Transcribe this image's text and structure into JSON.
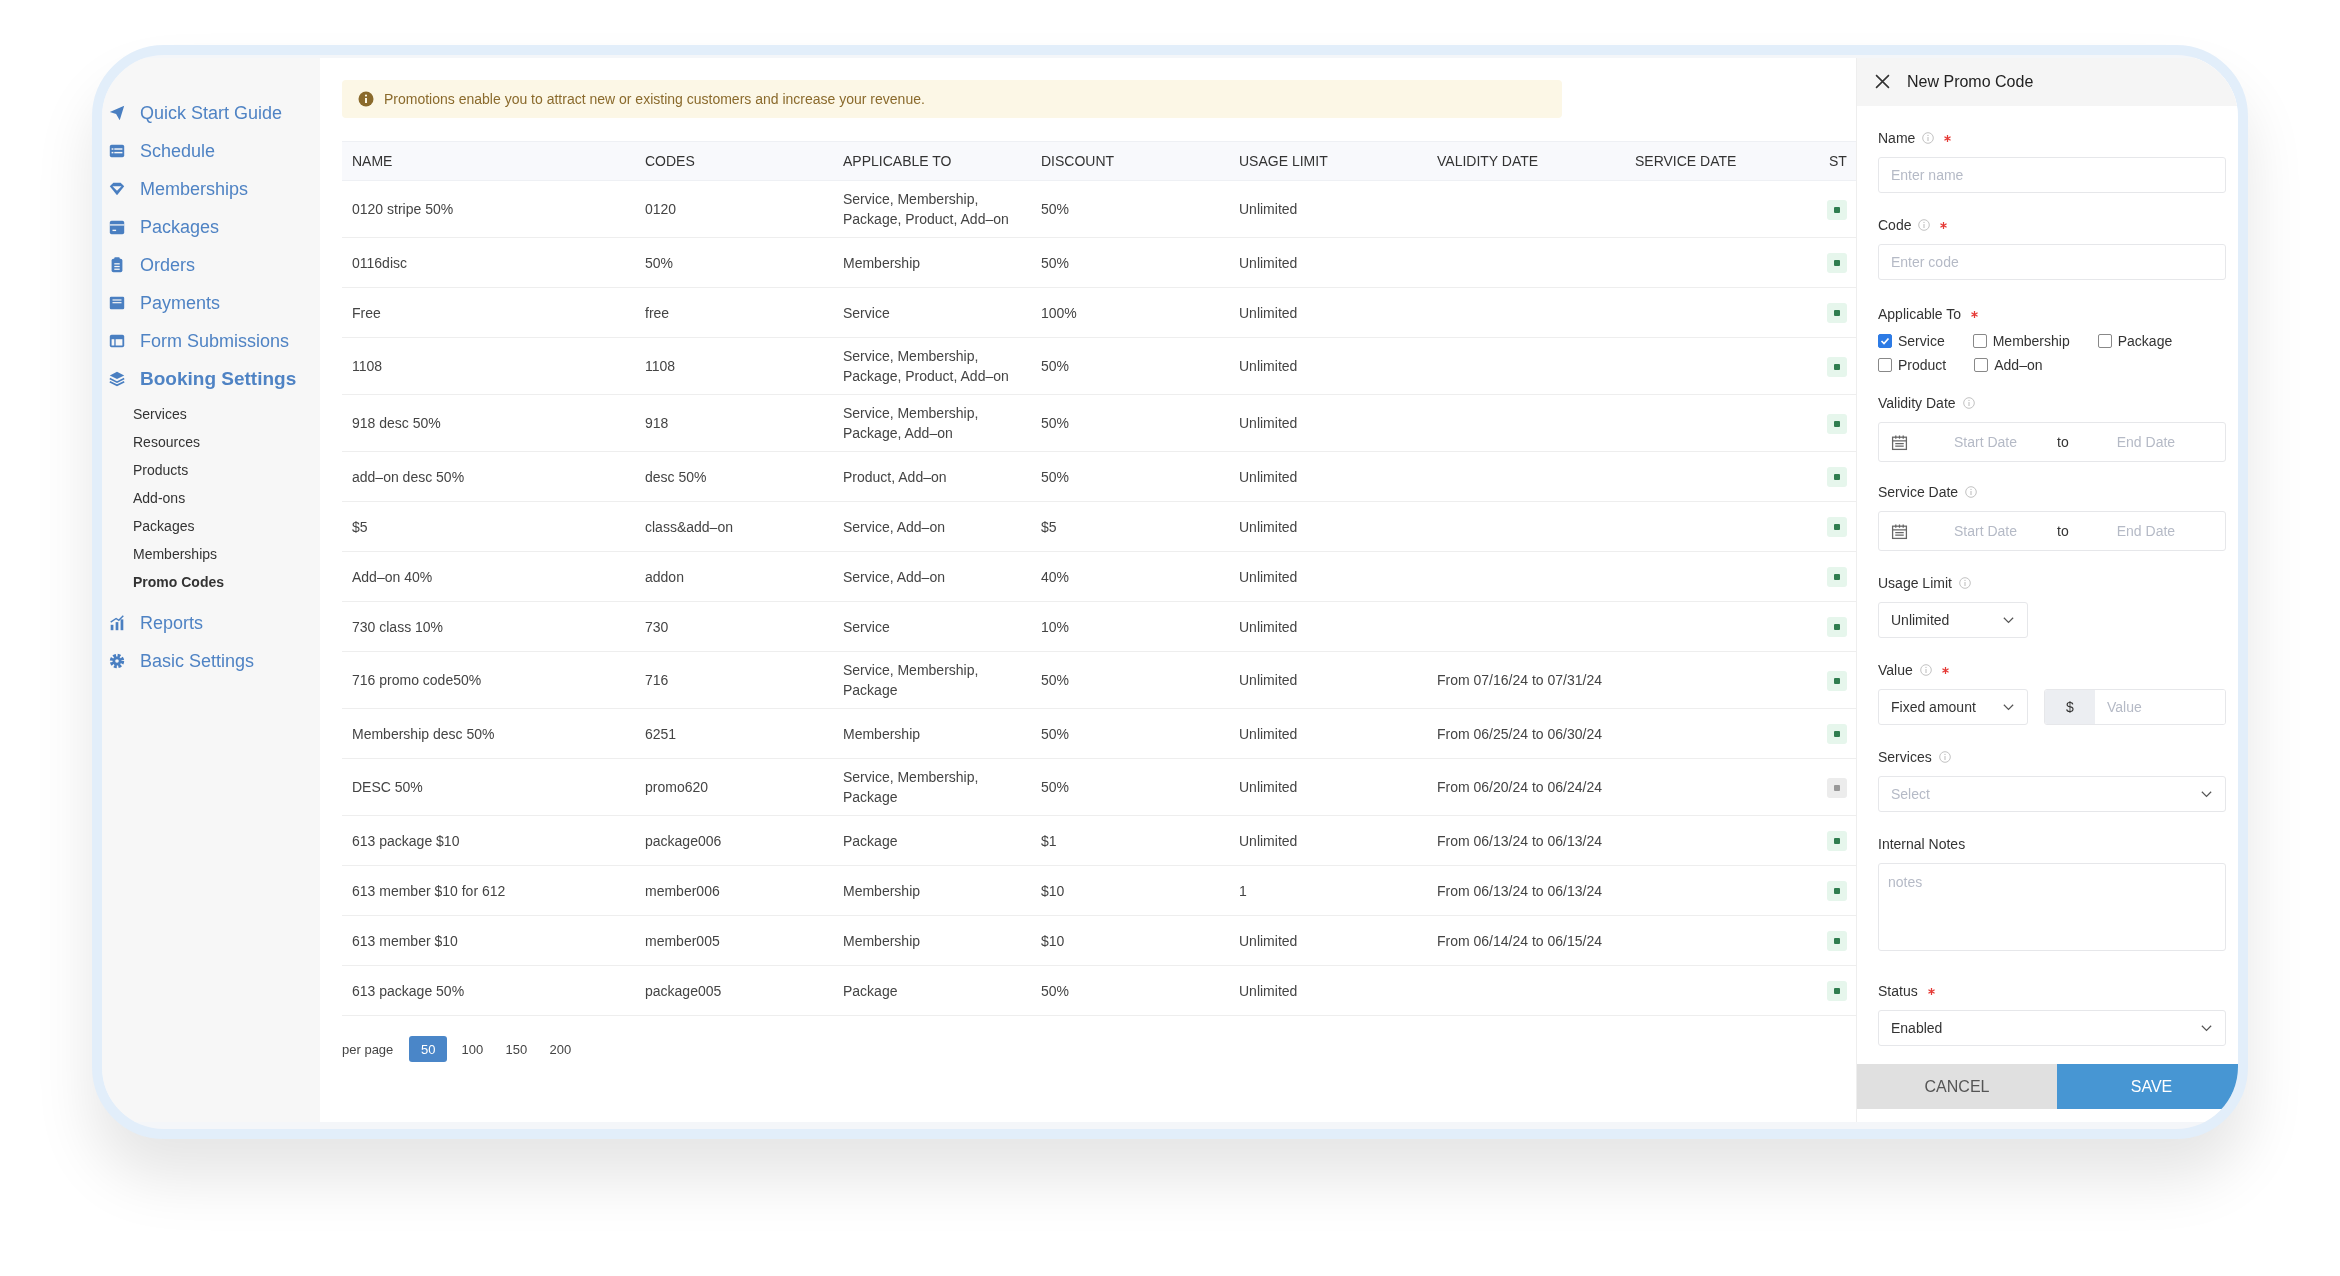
{
  "sidebar": {
    "items": [
      {
        "label": "Quick Start Guide",
        "expanded": false
      },
      {
        "label": "Schedule",
        "expanded": false
      },
      {
        "label": "Memberships",
        "expanded": false
      },
      {
        "label": "Packages",
        "expanded": false
      },
      {
        "label": "Orders",
        "expanded": false
      },
      {
        "label": "Payments",
        "expanded": false
      },
      {
        "label": "Form Submissions",
        "expanded": false
      },
      {
        "label": "Booking Settings",
        "expanded": true,
        "children": [
          {
            "label": "Services",
            "selected": false
          },
          {
            "label": "Resources",
            "selected": false
          },
          {
            "label": "Products",
            "selected": false
          },
          {
            "label": "Add-ons",
            "selected": false
          },
          {
            "label": "Packages",
            "selected": false
          },
          {
            "label": "Memberships",
            "selected": false
          },
          {
            "label": "Promo Codes",
            "selected": true
          }
        ]
      },
      {
        "label": "Reports",
        "expanded": false
      },
      {
        "label": "Basic Settings",
        "expanded": false
      }
    ]
  },
  "notice": {
    "text": "Promotions enable you to attract new or existing customers and increase your revenue."
  },
  "table": {
    "columns": [
      "NAME",
      "CODES",
      "APPLICABLE TO",
      "DISCOUNT",
      "USAGE LIMIT",
      "VALIDITY DATE",
      "SERVICE DATE",
      "ST"
    ],
    "rows": [
      {
        "name": "0120 stripe 50%",
        "code": "0120",
        "applicable_to": "Service, Membership, Package, Product, Add–on",
        "discount": "50%",
        "usage_limit": "Unlimited",
        "enabled": true
      },
      {
        "name": "0116disc",
        "code": "50%",
        "applicable_to": "Membership",
        "discount": "50%",
        "usage_limit": "Unlimited",
        "enabled": true
      },
      {
        "name": "Free",
        "code": "free",
        "applicable_to": "Service",
        "discount": "100%",
        "usage_limit": "Unlimited",
        "enabled": true
      },
      {
        "name": "1108",
        "code": "1108",
        "applicable_to": "Service, Membership, Package, Product, Add–on",
        "discount": "50%",
        "usage_limit": "Unlimited",
        "enabled": true
      },
      {
        "name": "918 desc 50%",
        "code": "918",
        "applicable_to": "Service, Membership, Package, Add–on",
        "discount": "50%",
        "usage_limit": "Unlimited",
        "enabled": true
      },
      {
        "name": "add–on desc 50%",
        "code": "desc 50%",
        "applicable_to": "Product, Add–on",
        "discount": "50%",
        "usage_limit": "Unlimited",
        "enabled": true
      },
      {
        "name": "$5",
        "code": "class&add–on",
        "applicable_to": "Service, Add–on",
        "discount": "$5",
        "usage_limit": "Unlimited",
        "enabled": true
      },
      {
        "name": "Add–on 40%",
        "code": "addon",
        "applicable_to": "Service, Add–on",
        "discount": "40%",
        "usage_limit": "Unlimited",
        "enabled": true
      },
      {
        "name": "730 class 10%",
        "code": "730",
        "applicable_to": "Service",
        "discount": "10%",
        "usage_limit": "Unlimited",
        "enabled": true
      },
      {
        "name": "716 promo code50%",
        "code": "716",
        "applicable_to": "Service, Membership, Package",
        "discount": "50%",
        "usage_limit": "Unlimited",
        "validity_date": "From 07/16/24 to 07/31/24",
        "enabled": true
      },
      {
        "name": "Membership desc 50%",
        "code": "6251",
        "applicable_to": "Membership",
        "discount": "50%",
        "usage_limit": "Unlimited",
        "validity_date": "From 06/25/24 to 06/30/24",
        "enabled": true
      },
      {
        "name": "DESC 50%",
        "code": "promo620",
        "applicable_to": "Service, Membership, Package",
        "discount": "50%",
        "usage_limit": "Unlimited",
        "validity_date": "From 06/20/24 to 06/24/24",
        "enabled": false
      },
      {
        "name": "613 package $10",
        "code": "package006",
        "applicable_to": "Package",
        "discount": "$1",
        "usage_limit": "Unlimited",
        "validity_date": "From 06/13/24 to 06/13/24",
        "enabled": true
      },
      {
        "name": "613 member $10 for 612",
        "code": "member006",
        "applicable_to": "Membership",
        "discount": "$10",
        "usage_limit": "1",
        "validity_date": "From 06/13/24 to 06/13/24",
        "enabled": true
      },
      {
        "name": "613 member $10",
        "code": "member005",
        "applicable_to": "Membership",
        "discount": "$10",
        "usage_limit": "Unlimited",
        "validity_date": "From 06/14/24 to 06/15/24",
        "enabled": true
      },
      {
        "name": "613 package 50%",
        "code": "package005",
        "applicable_to": "Package",
        "discount": "50%",
        "usage_limit": "Unlimited",
        "enabled": true
      }
    ]
  },
  "pagination": {
    "label": "per page",
    "options": [
      {
        "label": "50",
        "selected": true
      },
      {
        "label": "100",
        "selected": false
      },
      {
        "label": "150",
        "selected": false
      },
      {
        "label": "200",
        "selected": false
      }
    ]
  },
  "panel": {
    "title": "New Promo Code",
    "fields": [
      {
        "kind": "text",
        "label": "Name",
        "info": true,
        "required": true,
        "placeholder": "Enter name"
      },
      {
        "kind": "text",
        "label": "Code",
        "info": true,
        "required": true,
        "placeholder": "Enter code"
      },
      {
        "kind": "checkboxes",
        "label": "Applicable To",
        "info": false,
        "required": true,
        "options": [
          {
            "label": "Service",
            "checked": true
          },
          {
            "label": "Membership",
            "checked": false
          },
          {
            "label": "Package",
            "checked": false
          },
          {
            "label": "Product",
            "checked": false
          },
          {
            "label": "Add–on",
            "checked": false
          }
        ]
      },
      {
        "kind": "daterange",
        "label": "Validity Date",
        "info": true,
        "required": false,
        "start": "Start Date",
        "separator": "to",
        "end": "End Date"
      },
      {
        "kind": "daterange",
        "label": "Service Date",
        "info": true,
        "required": false,
        "start": "Start Date",
        "separator": "to",
        "end": "End Date"
      },
      {
        "kind": "dropdown",
        "label": "Usage Limit",
        "info": true,
        "required": false,
        "value": "Unlimited"
      },
      {
        "kind": "amount",
        "label": "Value",
        "info": true,
        "required": true,
        "value": "Fixed amount",
        "prefix": "$",
        "placeholder": "Value"
      },
      {
        "kind": "select",
        "label": "Services",
        "info": true,
        "required": false,
        "placeholder": "Select"
      },
      {
        "kind": "textarea",
        "label": "Internal Notes",
        "info": false,
        "required": false,
        "placeholder": "notes"
      },
      {
        "kind": "select",
        "label": "Status",
        "info": false,
        "required": true,
        "value": "Enabled"
      }
    ],
    "buttons": [
      {
        "label": "CANCEL",
        "kind": "secondary"
      },
      {
        "label": "SAVE",
        "kind": "primary"
      }
    ]
  }
}
